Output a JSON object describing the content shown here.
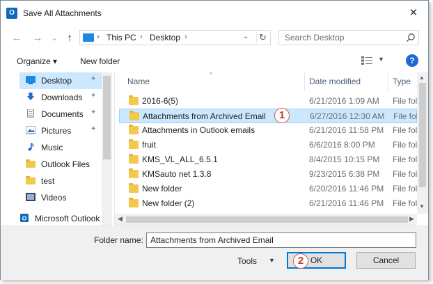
{
  "window": {
    "title": "Save All Attachments",
    "app_icon_letter": "O",
    "close_glyph": "✕"
  },
  "nav": {
    "back": "←",
    "forward": "→",
    "recent": "⌄",
    "up": "↑",
    "breadcrumb": [
      "This PC",
      "Desktop"
    ],
    "crumb_sep": "›",
    "dropdown": "⌄",
    "refresh": "↻",
    "search_placeholder": "Search Desktop"
  },
  "commands": {
    "organize": "Organize ▾",
    "new_folder": "New folder",
    "view_drop": "▼",
    "help": "?"
  },
  "sidebar": {
    "items": [
      {
        "label": "Desktop",
        "icon": "desktop-icon",
        "pinned": true,
        "selected": true
      },
      {
        "label": "Downloads",
        "icon": "download-icon",
        "pinned": true
      },
      {
        "label": "Documents",
        "icon": "documents-icon",
        "pinned": true
      },
      {
        "label": "Pictures",
        "icon": "pictures-icon",
        "pinned": true
      },
      {
        "label": "Music",
        "icon": "music-icon"
      },
      {
        "label": "Outlook Files",
        "icon": "folder-icon"
      },
      {
        "label": "test",
        "icon": "folder-icon"
      },
      {
        "label": "Videos",
        "icon": "videos-icon"
      },
      {
        "label": "Microsoft Outlook",
        "icon": "outlook-icon"
      }
    ],
    "pin_glyph": "📌"
  },
  "columns": {
    "name": "Name",
    "date": "Date modified",
    "type": "Type",
    "sort_glyph": "^"
  },
  "files": [
    {
      "name": "2016-6(5)",
      "date": "6/21/2016 1:09 AM",
      "type": "File fol"
    },
    {
      "name": "Attachments from Archived Email",
      "date": "6/27/2016 12:30 AM",
      "type": "File fol",
      "selected": true
    },
    {
      "name": "Attachments in Outlook emails",
      "date": "6/21/2016 11:58 PM",
      "type": "File fol"
    },
    {
      "name": "fruit",
      "date": "6/6/2016 8:00 PM",
      "type": "File fol"
    },
    {
      "name": "KMS_VL_ALL_6.5.1",
      "date": "8/4/2015 10:15 PM",
      "type": "File fol"
    },
    {
      "name": "KMSauto net 1.3.8",
      "date": "9/23/2015 6:38 PM",
      "type": "File fol"
    },
    {
      "name": "New folder",
      "date": "6/20/2016 11:46 PM",
      "type": "File fol"
    },
    {
      "name": "New folder (2)",
      "date": "6/21/2016 11:46 PM",
      "type": "File fol"
    }
  ],
  "badges": {
    "step1": "1",
    "step2": "2"
  },
  "footer": {
    "folder_name_label": "Folder name:",
    "folder_name_value": "Attachments from Archived Email",
    "tools": "Tools",
    "tools_drop": "▼",
    "ok": "OK",
    "cancel": "Cancel"
  },
  "colors": {
    "accent": "#0078d7",
    "selection": "#cce8ff",
    "badge_border": "#d9534f",
    "folder": "#f2c94c"
  }
}
